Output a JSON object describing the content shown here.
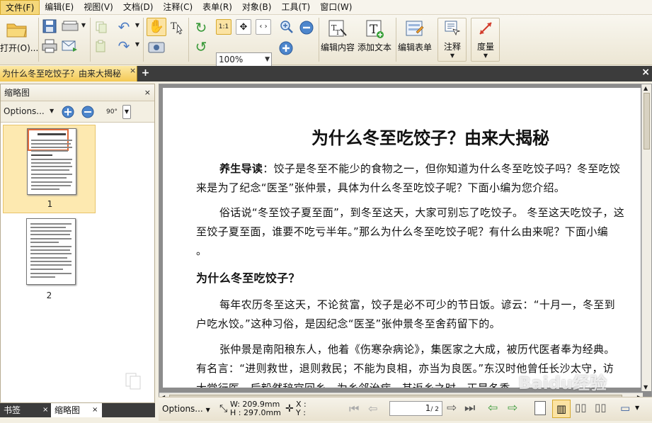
{
  "menu": [
    "文件(F)",
    "编辑(E)",
    "视图(V)",
    "文档(D)",
    "注释(C)",
    "表单(R)",
    "对象(B)",
    "工具(T)",
    "窗口(W)"
  ],
  "toolbar": {
    "open_label": "打开(O)...",
    "zoom_value": "100%",
    "zoom_fit_label": "1:1",
    "edit_content_label": "编辑内容",
    "add_text_label": "添加文本",
    "edit_form_label": "编辑表单",
    "annotate_label": "注释",
    "measure_label": "度量"
  },
  "doc_tab": {
    "title": "为什么冬至吃饺子？由来大揭秘",
    "close": "×",
    "new_tab": "+",
    "close_all": "×"
  },
  "sidebar": {
    "title": "缩略图",
    "close": "×",
    "options_label": "Options...",
    "rotate_label": "90°",
    "thumbnails": [
      {
        "label": "1"
      },
      {
        "label": "2"
      }
    ],
    "tabs": [
      "书签",
      "缩略图"
    ]
  },
  "document": {
    "title": "为什么冬至吃饺子？由来大揭秘",
    "lines": [
      "养生导读：饺子是冬至不能少的食物之一，但你知道为什么冬至吃饺子吗？冬至吃饺",
      "来是为了纪念“医圣”张仲景，具体为什么冬至吃饺子呢？下面小编为您介绍。",
      "俗话说“冬至饺子夏至面”，到冬至这天，大家可别忘了吃饺子。 冬至这天吃饺子，这",
      "至饺子夏至面，谁要不吃亏半年。”那么为什么冬至吃饺子呢？有什么由来呢？下面小编",
      "。",
      "为什么冬至吃饺子？",
      "每年农历冬至这天，不论贫富，饺子是必不可少的节日饭。谚云：“十月一，冬至到",
      "户吃水饺。”这种习俗，是因纪念“医圣”张仲景冬至舍药留下的。",
      "张仲景是南阳稂东人，他着《伤寒杂病论》，集医家之大成，被历代医者奉为经典。",
      "有名言：“进则救世，退则救民；不能为良相，亦当为良医。”东汉时他曾任长沙太守，访",
      "大堂行医。后毅然辞官回乡，为乡邻治病。其返乡之时，正是冬季。"
    ]
  },
  "status": {
    "options_label": "Options...",
    "width_label": "W: 209.9mm",
    "height_label": "H : 297.0mm",
    "x_label": "X :",
    "y_label": "Y :",
    "page_value": "1",
    "page_total": "/ 2"
  },
  "watermark": "Baidu经验",
  "colors": {
    "accent": "#f5d77a",
    "tab_active": "#f4c954",
    "chrome": "#f3efe2"
  }
}
